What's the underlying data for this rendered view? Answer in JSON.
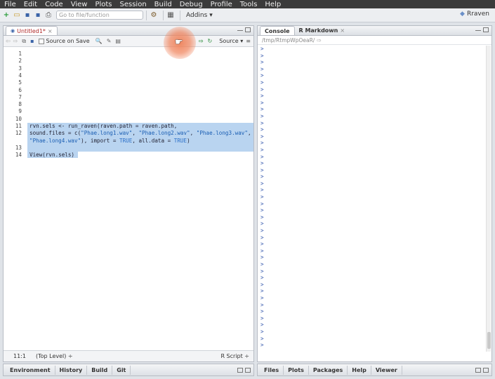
{
  "menu": [
    "File",
    "Edit",
    "Code",
    "View",
    "Plots",
    "Session",
    "Build",
    "Debug",
    "Profile",
    "Tools",
    "Help"
  ],
  "toolbar": {
    "goto_placeholder": "Go to file/function",
    "addins_label": "Addins",
    "addins_caret": "▾",
    "project_label": "Rraven",
    "new_file_glyph": "+",
    "open_glyph": "▭",
    "save_glyph": "▪",
    "save_all_glyph": "▪",
    "print_glyph": "⎙",
    "vcs_glyph": "⚙",
    "grid_glyph": "▦",
    "project_icon_glyph": "◆"
  },
  "editor": {
    "tab_label": "Untitled1*",
    "tab_close": "×",
    "source_on_save": "Source on Save",
    "run_label": "Run",
    "source_label": "Source",
    "source_caret": "▾",
    "menu_glyph": "≡",
    "back_glyph": "⇦",
    "forward_glyph": "⇨",
    "popout_glyph": "⧉",
    "save_glyph": "▪",
    "search_glyph": "🔍",
    "wand_glyph": "✎",
    "compile_glyph": "▤",
    "rerun_glyph": "↻",
    "line_numbers": [
      "1",
      "2",
      "3",
      "4",
      "5",
      "6",
      "7",
      "8",
      "9",
      "10",
      "11",
      "12",
      "",
      "13",
      "14"
    ],
    "code_lines": [
      "",
      "",
      "",
      "",
      "",
      "",
      "",
      "",
      "",
      "",
      "rvn.sels <- run_raven(raven.path = raven.path,",
      "sound.files = c(\"Phae.long1.wav\", \"Phae.long2.wav\", \"Phae.long3.wav\",",
      "\"Phae.long4.wav\"), import = TRUE, all.data = TRUE)",
      "",
      "View(rvn.sels)"
    ],
    "status_position": "11:1",
    "status_scope": "(Top Level)",
    "status_scope_caret": "÷",
    "status_type": "R Script",
    "status_type_caret": "÷"
  },
  "console": {
    "tab_console": "Console",
    "tab_markdown": "R Markdown",
    "tab_markdown_close": "×",
    "path": "/tmp/RtmpWpOeaR/",
    "path_glyph": "⇨",
    "prompt": ">",
    "prompt_count": 45
  },
  "bottom_left_tabs": [
    "Environment",
    "History",
    "Build",
    "Git"
  ],
  "bottom_right_tabs": [
    "Files",
    "Plots",
    "Packages",
    "Help",
    "Viewer"
  ],
  "colors": {
    "menubar": "#3b3b3b",
    "selection": "#b9d4f0",
    "prompt": "#2a4fa8",
    "string": "#1a5eb3"
  }
}
